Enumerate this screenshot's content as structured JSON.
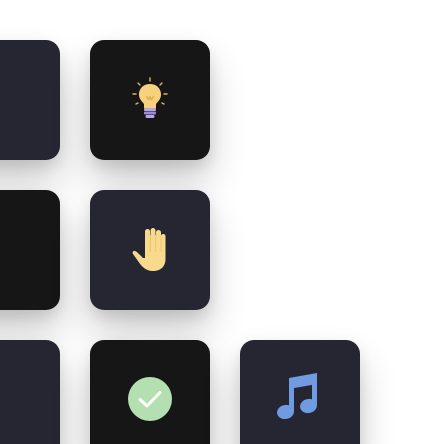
{
  "tiles": [
    {
      "id": "tile-left-top",
      "bg": "#262633",
      "icon": ""
    },
    {
      "id": "tile-bulb",
      "bg": "#161616",
      "icon": "lightbulb-icon"
    },
    {
      "id": "tile-left-middle",
      "bg": "#161616",
      "icon": ""
    },
    {
      "id": "tile-hand",
      "bg": "#262633",
      "icon": "raised-hand-icon"
    },
    {
      "id": "tile-left-bottom",
      "bg": "#262633",
      "icon": ""
    },
    {
      "id": "tile-check",
      "bg": "#161616",
      "icon": "check-circle-icon"
    },
    {
      "id": "tile-music",
      "bg": "#262633",
      "icon": "music-note-icon"
    }
  ],
  "colors": {
    "bulb": "#f7d27c",
    "hand": "#f8da8f",
    "check": "#b3dfb1",
    "music": "#6f9be0"
  }
}
